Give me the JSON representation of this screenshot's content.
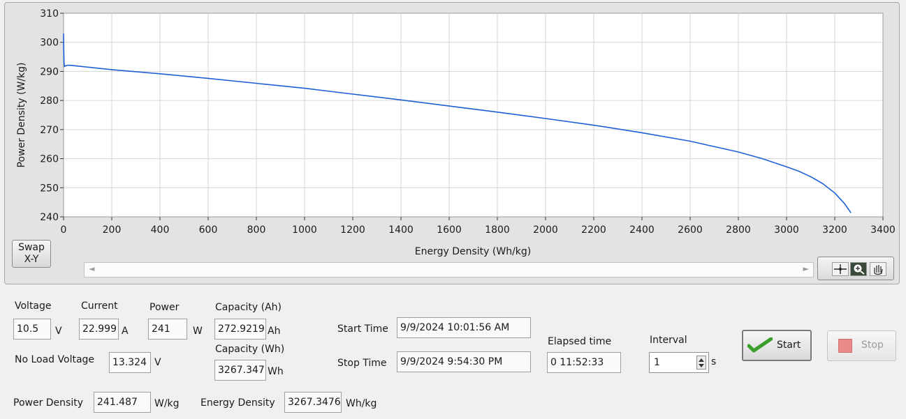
{
  "chart_data": {
    "type": "line",
    "xlabel": "Energy Density (Wh/kg)",
    "ylabel": "Power Density (W/kg)",
    "xlim": [
      0,
      3400
    ],
    "ylim": [
      240,
      310
    ],
    "xticks": [
      0,
      200,
      400,
      600,
      800,
      1000,
      1200,
      1400,
      1600,
      1800,
      2000,
      2200,
      2400,
      2600,
      2800,
      3000,
      3200,
      3400
    ],
    "yticks": [
      240,
      250,
      260,
      270,
      280,
      290,
      300,
      310
    ],
    "grid": true,
    "line_color": "#1f5fd6",
    "series": [
      {
        "x": [
          0,
          1,
          2,
          4,
          8,
          15,
          30,
          200,
          400,
          600,
          800,
          1000,
          1200,
          1400,
          1600,
          1800,
          2000,
          2200,
          2400,
          2600,
          2800,
          2900,
          3000,
          3050,
          3100,
          3150,
          3200,
          3240,
          3267
        ],
        "y": [
          303,
          297,
          293,
          291.7,
          291.9,
          292.1,
          292.1,
          290.6,
          289.2,
          287.6,
          285.9,
          284.2,
          282.2,
          280.2,
          278.1,
          276.0,
          273.8,
          271.5,
          268.9,
          266.0,
          262.3,
          260.0,
          257.2,
          255.7,
          253.8,
          251.4,
          248.2,
          244.6,
          241.4
        ]
      }
    ]
  },
  "graph": {
    "swap_button": {
      "line1": "Swap",
      "line2": "X-Y"
    },
    "scroll_left": "◄",
    "scroll_right": "►"
  },
  "readings": {
    "voltage": {
      "label": "Voltage",
      "value": "10.5",
      "unit": "V"
    },
    "current": {
      "label": "Current",
      "value": "22.999",
      "unit": "A"
    },
    "power": {
      "label": "Power",
      "value": "241",
      "unit": "W"
    },
    "capacity_ah": {
      "label": "Capacity (Ah)",
      "value": "272.9219",
      "unit": "Ah"
    },
    "capacity_wh": {
      "label": "Capacity (Wh)",
      "value": "3267.347",
      "unit": "Wh"
    },
    "no_load_voltage": {
      "label": "No Load Voltage",
      "value": "13.324",
      "unit": "V"
    },
    "start_time": {
      "label": "Start Time",
      "value": "9/9/2024 10:01:56 AM"
    },
    "stop_time": {
      "label": "Stop Time",
      "value": "9/9/2024 9:54:30 PM"
    },
    "elapsed": {
      "label": "Elapsed time",
      "value": "0  11:52:33"
    },
    "interval": {
      "label": "Interval",
      "value": "1",
      "unit": "s"
    },
    "power_density": {
      "label": "Power Density",
      "value": "241.487",
      "unit": "W/kg"
    },
    "energy_density": {
      "label": "Energy Density",
      "value": "3267.3476",
      "unit": "Wh/kg"
    }
  },
  "controls": {
    "start_label": "Start",
    "stop_label": "Stop"
  }
}
